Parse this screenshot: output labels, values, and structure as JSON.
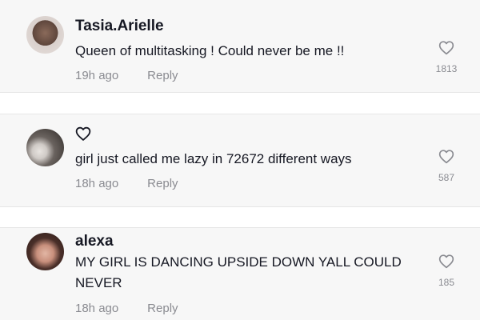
{
  "comments": [
    {
      "author": "Tasia.Arielle",
      "text": "Queen of multitasking ! Could never be me !!",
      "time": "19h ago",
      "reply_label": "Reply",
      "likes": "1813",
      "avatar_icon": "profile-photo"
    },
    {
      "author": "",
      "author_icon": "heart-outline-icon",
      "text": "girl just called me lazy in 72672 different ways",
      "time": "18h ago",
      "reply_label": "Reply",
      "likes": "587",
      "avatar_icon": "profile-photo"
    },
    {
      "author": "alexa",
      "text": "MY GIRL IS DANCING UPSIDE DOWN YALL COULD NEVER",
      "time": "18h ago",
      "reply_label": "Reply",
      "likes": "185",
      "avatar_icon": "profile-photo"
    }
  ],
  "colors": {
    "card_background": "#f7f7f7",
    "text_primary": "#161823",
    "text_secondary": "#8a8b91",
    "heart_stroke": "#8a8b91",
    "divider": "#e6e6e6"
  }
}
